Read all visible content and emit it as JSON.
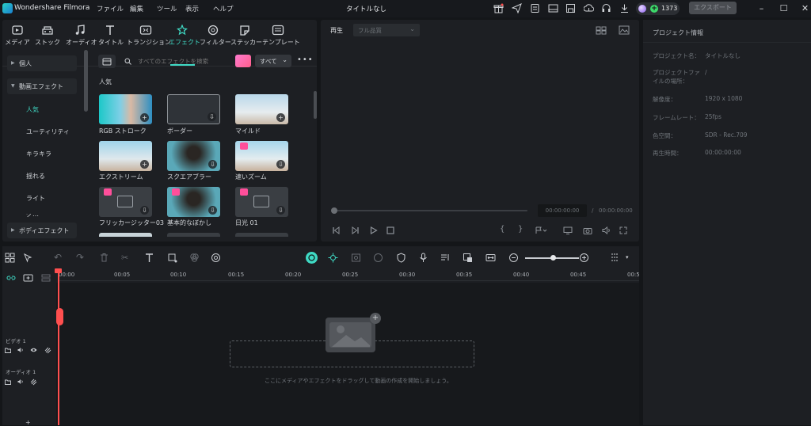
{
  "app": {
    "name": "Wondershare Filmora",
    "document_title": "タイトルなし"
  },
  "menu": [
    "ファイル",
    "編集",
    "ツール",
    "表示",
    "ヘルプ"
  ],
  "titlebar": {
    "credits": "1373",
    "export_label": "エクスポート"
  },
  "library": {
    "tabs": [
      {
        "label": "メディア",
        "icon": "media-icon"
      },
      {
        "label": "ストック",
        "icon": "stock-icon"
      },
      {
        "label": "オーディオ",
        "icon": "music-icon"
      },
      {
        "label": "タイトル",
        "icon": "title-icon"
      },
      {
        "label": "トランジション",
        "icon": "transition-icon"
      },
      {
        "label": "エフェクト",
        "icon": "effect-icon",
        "active": true
      },
      {
        "label": "フィルター",
        "icon": "filter-icon"
      },
      {
        "label": "ステッカー",
        "icon": "sticker-icon"
      },
      {
        "label": "テンプレート",
        "icon": "template-icon"
      }
    ],
    "sidebar": {
      "groups": [
        {
          "label": "個人"
        },
        {
          "label": "動画エフェクト"
        },
        {
          "label": "ボディエフェクト"
        }
      ],
      "subitems": [
        "人気",
        "ユーティリティ",
        "キラキラ",
        "揺れる",
        "ライト",
        "グ…"
      ]
    },
    "search": {
      "placeholder": "すべてのエフェクトを検索"
    },
    "filter": {
      "selected": "すべて"
    },
    "section_title": "人気",
    "effects": [
      {
        "label": "RGB ストローク"
      },
      {
        "label": "ボーダー"
      },
      {
        "label": "マイルド"
      },
      {
        "label": "エクストリーム"
      },
      {
        "label": "スクエアブラー"
      },
      {
        "label": "速いズーム"
      },
      {
        "label": "フリッカージッター03"
      },
      {
        "label": "基本的なぼかし"
      },
      {
        "label": "日光 01"
      }
    ]
  },
  "preview": {
    "tab": "再生",
    "quality": "フル品質",
    "timecode": "00:00:00:00",
    "separator": "/",
    "total": "00:00:00:00"
  },
  "properties": {
    "title": "プロジェクト情報",
    "rows": [
      {
        "label": "プロジェクト名：",
        "value": "タイトルなし"
      },
      {
        "label": "プロジェクトファ\nイルの場所：",
        "value": "/"
      },
      {
        "label": "解像度：",
        "value": "1920 x 1080"
      },
      {
        "label": "フレームレート：",
        "value": "25fps"
      },
      {
        "label": "色空間：",
        "value": "SDR - Rec.709"
      },
      {
        "label": "再生時間：",
        "value": "00:00:00:00"
      }
    ]
  },
  "timeline": {
    "ruler": [
      "00:00",
      "00:05",
      "00:10",
      "00:15",
      "00:20",
      "00:25",
      "00:30",
      "00:35",
      "00:40",
      "00:45",
      "00:5"
    ],
    "tracks": [
      {
        "label": "ビデオ 1"
      },
      {
        "label": "オーディオ 1"
      }
    ],
    "drop_hint": "ここにメディアやエフェクトをドラッグして動画の作成を開始しましょう。"
  }
}
